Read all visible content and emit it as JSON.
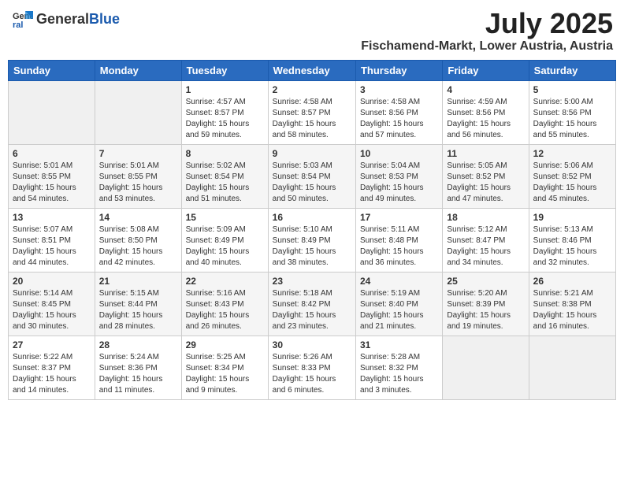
{
  "header": {
    "logo_general": "General",
    "logo_blue": "Blue",
    "month": "July 2025",
    "location": "Fischamend-Markt, Lower Austria, Austria"
  },
  "weekdays": [
    "Sunday",
    "Monday",
    "Tuesday",
    "Wednesday",
    "Thursday",
    "Friday",
    "Saturday"
  ],
  "weeks": [
    [
      {
        "day": "",
        "info": ""
      },
      {
        "day": "",
        "info": ""
      },
      {
        "day": "1",
        "info": "Sunrise: 4:57 AM\nSunset: 8:57 PM\nDaylight: 15 hours\nand 59 minutes."
      },
      {
        "day": "2",
        "info": "Sunrise: 4:58 AM\nSunset: 8:57 PM\nDaylight: 15 hours\nand 58 minutes."
      },
      {
        "day": "3",
        "info": "Sunrise: 4:58 AM\nSunset: 8:56 PM\nDaylight: 15 hours\nand 57 minutes."
      },
      {
        "day": "4",
        "info": "Sunrise: 4:59 AM\nSunset: 8:56 PM\nDaylight: 15 hours\nand 56 minutes."
      },
      {
        "day": "5",
        "info": "Sunrise: 5:00 AM\nSunset: 8:56 PM\nDaylight: 15 hours\nand 55 minutes."
      }
    ],
    [
      {
        "day": "6",
        "info": "Sunrise: 5:01 AM\nSunset: 8:55 PM\nDaylight: 15 hours\nand 54 minutes."
      },
      {
        "day": "7",
        "info": "Sunrise: 5:01 AM\nSunset: 8:55 PM\nDaylight: 15 hours\nand 53 minutes."
      },
      {
        "day": "8",
        "info": "Sunrise: 5:02 AM\nSunset: 8:54 PM\nDaylight: 15 hours\nand 51 minutes."
      },
      {
        "day": "9",
        "info": "Sunrise: 5:03 AM\nSunset: 8:54 PM\nDaylight: 15 hours\nand 50 minutes."
      },
      {
        "day": "10",
        "info": "Sunrise: 5:04 AM\nSunset: 8:53 PM\nDaylight: 15 hours\nand 49 minutes."
      },
      {
        "day": "11",
        "info": "Sunrise: 5:05 AM\nSunset: 8:52 PM\nDaylight: 15 hours\nand 47 minutes."
      },
      {
        "day": "12",
        "info": "Sunrise: 5:06 AM\nSunset: 8:52 PM\nDaylight: 15 hours\nand 45 minutes."
      }
    ],
    [
      {
        "day": "13",
        "info": "Sunrise: 5:07 AM\nSunset: 8:51 PM\nDaylight: 15 hours\nand 44 minutes."
      },
      {
        "day": "14",
        "info": "Sunrise: 5:08 AM\nSunset: 8:50 PM\nDaylight: 15 hours\nand 42 minutes."
      },
      {
        "day": "15",
        "info": "Sunrise: 5:09 AM\nSunset: 8:49 PM\nDaylight: 15 hours\nand 40 minutes."
      },
      {
        "day": "16",
        "info": "Sunrise: 5:10 AM\nSunset: 8:49 PM\nDaylight: 15 hours\nand 38 minutes."
      },
      {
        "day": "17",
        "info": "Sunrise: 5:11 AM\nSunset: 8:48 PM\nDaylight: 15 hours\nand 36 minutes."
      },
      {
        "day": "18",
        "info": "Sunrise: 5:12 AM\nSunset: 8:47 PM\nDaylight: 15 hours\nand 34 minutes."
      },
      {
        "day": "19",
        "info": "Sunrise: 5:13 AM\nSunset: 8:46 PM\nDaylight: 15 hours\nand 32 minutes."
      }
    ],
    [
      {
        "day": "20",
        "info": "Sunrise: 5:14 AM\nSunset: 8:45 PM\nDaylight: 15 hours\nand 30 minutes."
      },
      {
        "day": "21",
        "info": "Sunrise: 5:15 AM\nSunset: 8:44 PM\nDaylight: 15 hours\nand 28 minutes."
      },
      {
        "day": "22",
        "info": "Sunrise: 5:16 AM\nSunset: 8:43 PM\nDaylight: 15 hours\nand 26 minutes."
      },
      {
        "day": "23",
        "info": "Sunrise: 5:18 AM\nSunset: 8:42 PM\nDaylight: 15 hours\nand 23 minutes."
      },
      {
        "day": "24",
        "info": "Sunrise: 5:19 AM\nSunset: 8:40 PM\nDaylight: 15 hours\nand 21 minutes."
      },
      {
        "day": "25",
        "info": "Sunrise: 5:20 AM\nSunset: 8:39 PM\nDaylight: 15 hours\nand 19 minutes."
      },
      {
        "day": "26",
        "info": "Sunrise: 5:21 AM\nSunset: 8:38 PM\nDaylight: 15 hours\nand 16 minutes."
      }
    ],
    [
      {
        "day": "27",
        "info": "Sunrise: 5:22 AM\nSunset: 8:37 PM\nDaylight: 15 hours\nand 14 minutes."
      },
      {
        "day": "28",
        "info": "Sunrise: 5:24 AM\nSunset: 8:36 PM\nDaylight: 15 hours\nand 11 minutes."
      },
      {
        "day": "29",
        "info": "Sunrise: 5:25 AM\nSunset: 8:34 PM\nDaylight: 15 hours\nand 9 minutes."
      },
      {
        "day": "30",
        "info": "Sunrise: 5:26 AM\nSunset: 8:33 PM\nDaylight: 15 hours\nand 6 minutes."
      },
      {
        "day": "31",
        "info": "Sunrise: 5:28 AM\nSunset: 8:32 PM\nDaylight: 15 hours\nand 3 minutes."
      },
      {
        "day": "",
        "info": ""
      },
      {
        "day": "",
        "info": ""
      }
    ]
  ]
}
